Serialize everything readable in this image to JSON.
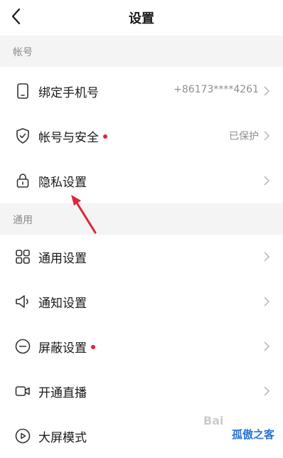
{
  "header": {
    "title": "设置"
  },
  "sections": {
    "account": {
      "label": "帐号"
    },
    "general": {
      "label": "通用"
    }
  },
  "rows": [
    {
      "name": "bind-phone",
      "label": "绑定手机号",
      "value": "+86173****4261",
      "icon": "phone-icon",
      "dot": false
    },
    {
      "name": "account-security",
      "label": "帐号与安全",
      "value": "已保护",
      "icon": "shield-icon",
      "dot": true
    },
    {
      "name": "privacy-settings",
      "label": "隐私设置",
      "value": "",
      "icon": "lock-icon",
      "dot": false
    },
    {
      "name": "general-settings",
      "label": "通用设置",
      "value": "",
      "icon": "grid-icon",
      "dot": false
    },
    {
      "name": "notification-settings",
      "label": "通知设置",
      "value": "",
      "icon": "speaker-icon",
      "dot": false
    },
    {
      "name": "block-settings",
      "label": "屏蔽设置",
      "value": "",
      "icon": "minus-circle-icon",
      "dot": true
    },
    {
      "name": "start-live",
      "label": "开通直播",
      "value": "",
      "icon": "video-camera-icon",
      "dot": false
    },
    {
      "name": "large-screen",
      "label": "大屏模式",
      "value": "",
      "icon": "play-circle-icon",
      "dot": false
    }
  ],
  "watermark": {
    "brand": "Bai",
    "text": "孤傲之客"
  },
  "colors": {
    "dot": "#e0243a",
    "annotation_arrow": "#e0243a",
    "watermark_text": "#2b73d6"
  }
}
